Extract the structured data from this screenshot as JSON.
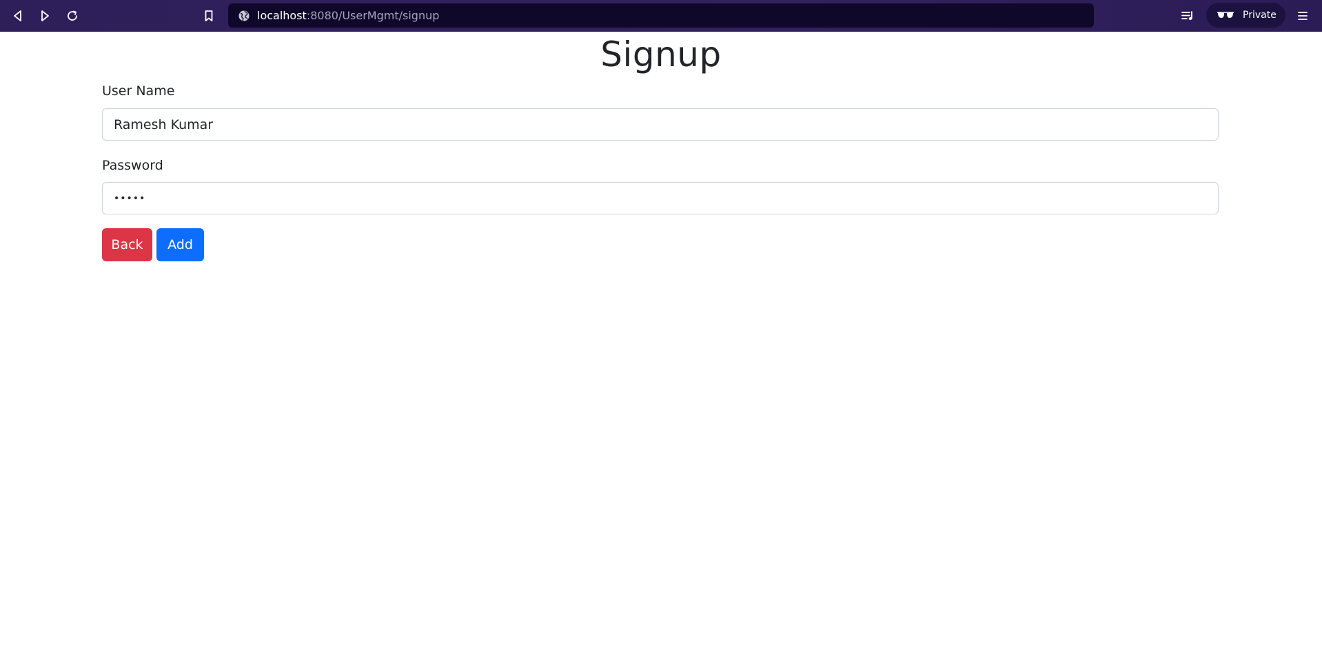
{
  "browser": {
    "url_host": "localhost",
    "url_rest": ":8080/UserMgmt/signup",
    "private_label": "Private",
    "toolbar_color": "#2e1f5a"
  },
  "page": {
    "title": "Signup",
    "form": {
      "username_label": "User Name",
      "username_value": "Ramesh Kumar",
      "password_label": "Password",
      "password_value": "•••••"
    },
    "buttons": {
      "back_label": "Back",
      "back_color": "#dc3545",
      "add_label": "Add",
      "add_color": "#0d6efd"
    }
  },
  "icons": [
    "back-arrow-icon",
    "forward-arrow-icon",
    "reload-icon",
    "bookmark-icon",
    "globe-icon",
    "playlist-icon",
    "private-glasses-icon",
    "hamburger-menu-icon"
  ]
}
